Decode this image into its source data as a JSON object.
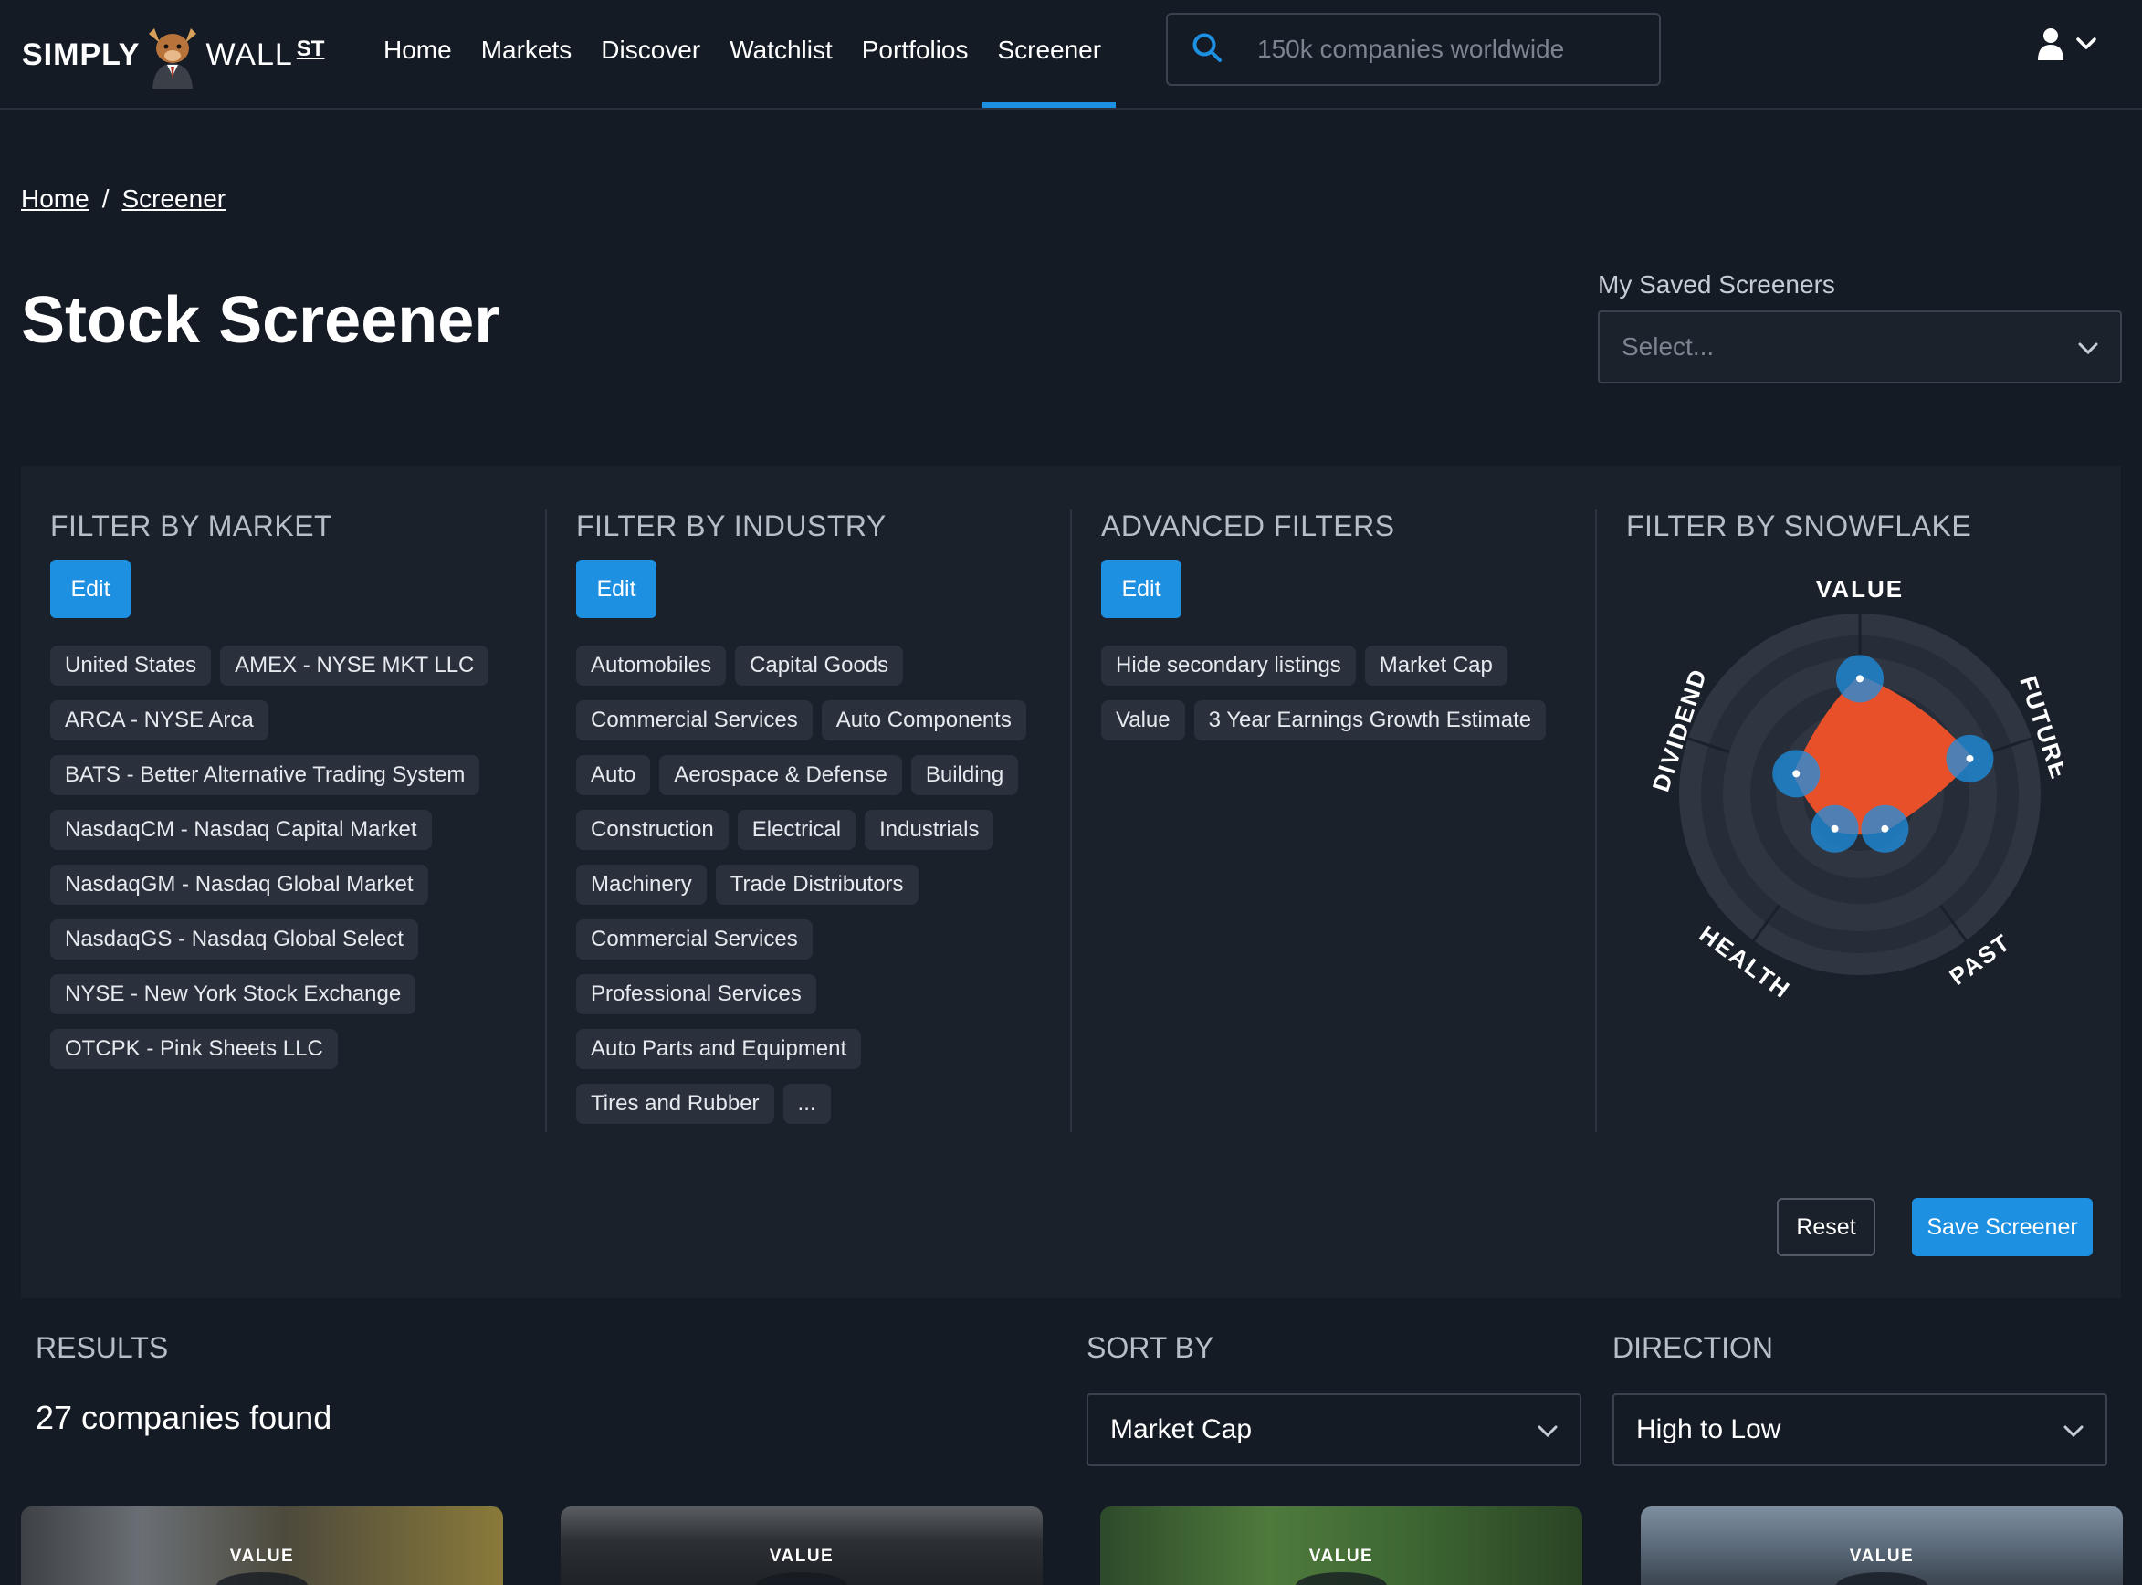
{
  "nav": {
    "logo": {
      "simply": "SIMPLY",
      "wall": "WALL",
      "st": "ST"
    },
    "links": [
      "Home",
      "Markets",
      "Discover",
      "Watchlist",
      "Portfolios",
      "Screener"
    ],
    "active_link": "Screener",
    "search_placeholder": "150k companies worldwide"
  },
  "breadcrumb": {
    "home": "Home",
    "sep": "/",
    "current": "Screener"
  },
  "page_title": "Stock Screener",
  "saved": {
    "label": "My Saved Screeners",
    "placeholder": "Select..."
  },
  "filters": {
    "market": {
      "title": "FILTER BY MARKET",
      "edit": "Edit",
      "rows": [
        [
          "United States",
          "AMEX - NYSE MKT LLC"
        ],
        [
          "ARCA - NYSE Arca"
        ],
        [
          "BATS - Better Alternative Trading System"
        ],
        [
          "NasdaqCM - Nasdaq Capital Market"
        ],
        [
          "NasdaqGM - Nasdaq Global Market"
        ],
        [
          "NasdaqGS - Nasdaq Global Select"
        ],
        [
          "NYSE - New York Stock Exchange"
        ],
        [
          "OTCPK - Pink Sheets LLC"
        ]
      ]
    },
    "industry": {
      "title": "FILTER BY INDUSTRY",
      "edit": "Edit",
      "rows": [
        [
          "Automobiles",
          "Capital Goods"
        ],
        [
          "Commercial Services",
          "Auto Components"
        ],
        [
          "Auto",
          "Aerospace & Defense",
          "Building"
        ],
        [
          "Construction",
          "Electrical",
          "Industrials"
        ],
        [
          "Machinery",
          "Trade Distributors"
        ],
        [
          "Commercial Services"
        ],
        [
          "Professional Services"
        ],
        [
          "Auto Parts and Equipment"
        ],
        [
          "Tires and Rubber",
          "..."
        ]
      ]
    },
    "advanced": {
      "title": "ADVANCED FILTERS",
      "edit": "Edit",
      "rows": [
        [
          "Hide secondary listings",
          "Market Cap"
        ],
        [
          "Value",
          "3 Year Earnings Growth Estimate"
        ]
      ]
    },
    "snowflake": {
      "title": "FILTER BY SNOWFLAKE",
      "axes": [
        "VALUE",
        "FUTURE",
        "PAST",
        "HEALTH",
        "DIVIDEND"
      ],
      "levels": {
        "value": 4,
        "future": 4,
        "past": 1,
        "health": 1,
        "dividend": 2
      },
      "fill_color": "#e8502a"
    }
  },
  "actions": {
    "reset": "Reset",
    "save": "Save Screener"
  },
  "results": {
    "label": "RESULTS",
    "count_text": "27 companies found",
    "sort_label": "SORT BY",
    "sort_value": "Market Cap",
    "direction_label": "DIRECTION",
    "direction_value": "High to Low"
  },
  "cards": [
    {
      "badge": "VALUE"
    },
    {
      "badge": "VALUE"
    },
    {
      "badge": "VALUE"
    },
    {
      "badge": "VALUE"
    }
  ],
  "colors": {
    "accent": "#1d90e2",
    "background": "#151b24",
    "panel": "#1b212b",
    "tag": "#2a313c"
  }
}
